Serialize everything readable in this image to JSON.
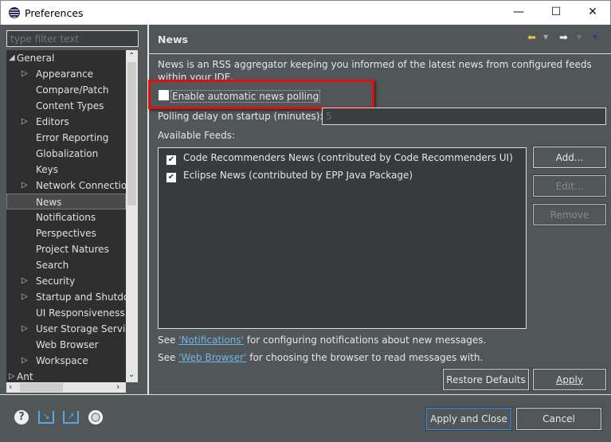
{
  "window": {
    "title": "Preferences",
    "minimize": "—",
    "maximize": "☐",
    "close": "✕"
  },
  "sidebar": {
    "filter_placeholder": "type filter text",
    "items": [
      {
        "label": "General",
        "level": 0,
        "expanded": true
      },
      {
        "label": "Appearance",
        "level": 1,
        "arrow": true
      },
      {
        "label": "Compare/Patch",
        "level": 1
      },
      {
        "label": "Content Types",
        "level": 1
      },
      {
        "label": "Editors",
        "level": 1,
        "arrow": true
      },
      {
        "label": "Error Reporting",
        "level": 1
      },
      {
        "label": "Globalization",
        "level": 1
      },
      {
        "label": "Keys",
        "level": 1
      },
      {
        "label": "Network Connections",
        "level": 1,
        "arrow": true
      },
      {
        "label": "News",
        "level": 1,
        "selected": true
      },
      {
        "label": "Notifications",
        "level": 1
      },
      {
        "label": "Perspectives",
        "level": 1
      },
      {
        "label": "Project Natures",
        "level": 1
      },
      {
        "label": "Search",
        "level": 1
      },
      {
        "label": "Security",
        "level": 1,
        "arrow": true
      },
      {
        "label": "Startup and Shutdown",
        "level": 1,
        "arrow": true
      },
      {
        "label": "UI Responsiveness",
        "level": 1
      },
      {
        "label": "User Storage Service",
        "level": 1,
        "arrow": true
      },
      {
        "label": "Web Browser",
        "level": 1
      },
      {
        "label": "Workspace",
        "level": 1,
        "arrow": true
      },
      {
        "label": "Ant",
        "level": 0,
        "arrow": true
      }
    ]
  },
  "page": {
    "title": "News",
    "description": "News is an RSS aggregator keeping you informed of the latest news from configured feeds within your IDE.",
    "enable_polling_label": "Enable automatic news polling",
    "enable_polling_checked": false,
    "polling_delay_label": "Polling delay on startup (minutes):",
    "polling_delay_value": "5",
    "feeds_label": "Available Feeds:",
    "feeds": [
      {
        "label": "Code Recommenders News (contributed by Code Recommenders UI)",
        "checked": true
      },
      {
        "label": "Eclipse News (contributed by EPP Java Package)",
        "checked": true
      }
    ],
    "add": "Add...",
    "edit": "Edit...",
    "remove": "Remove",
    "see1": "See ",
    "link1": "'Notifications'",
    "after1": " for configuring notifications about new messages.",
    "see2": "See ",
    "link2": "'Web Browser'",
    "after2": " for choosing the browser to read messages with.",
    "restore_defaults": "Restore Defaults",
    "apply": "Apply"
  },
  "footer": {
    "apply_close": "Apply and Close",
    "cancel": "Cancel"
  },
  "colors": {
    "highlight": "#e01010",
    "link": "#6fb6e8"
  }
}
